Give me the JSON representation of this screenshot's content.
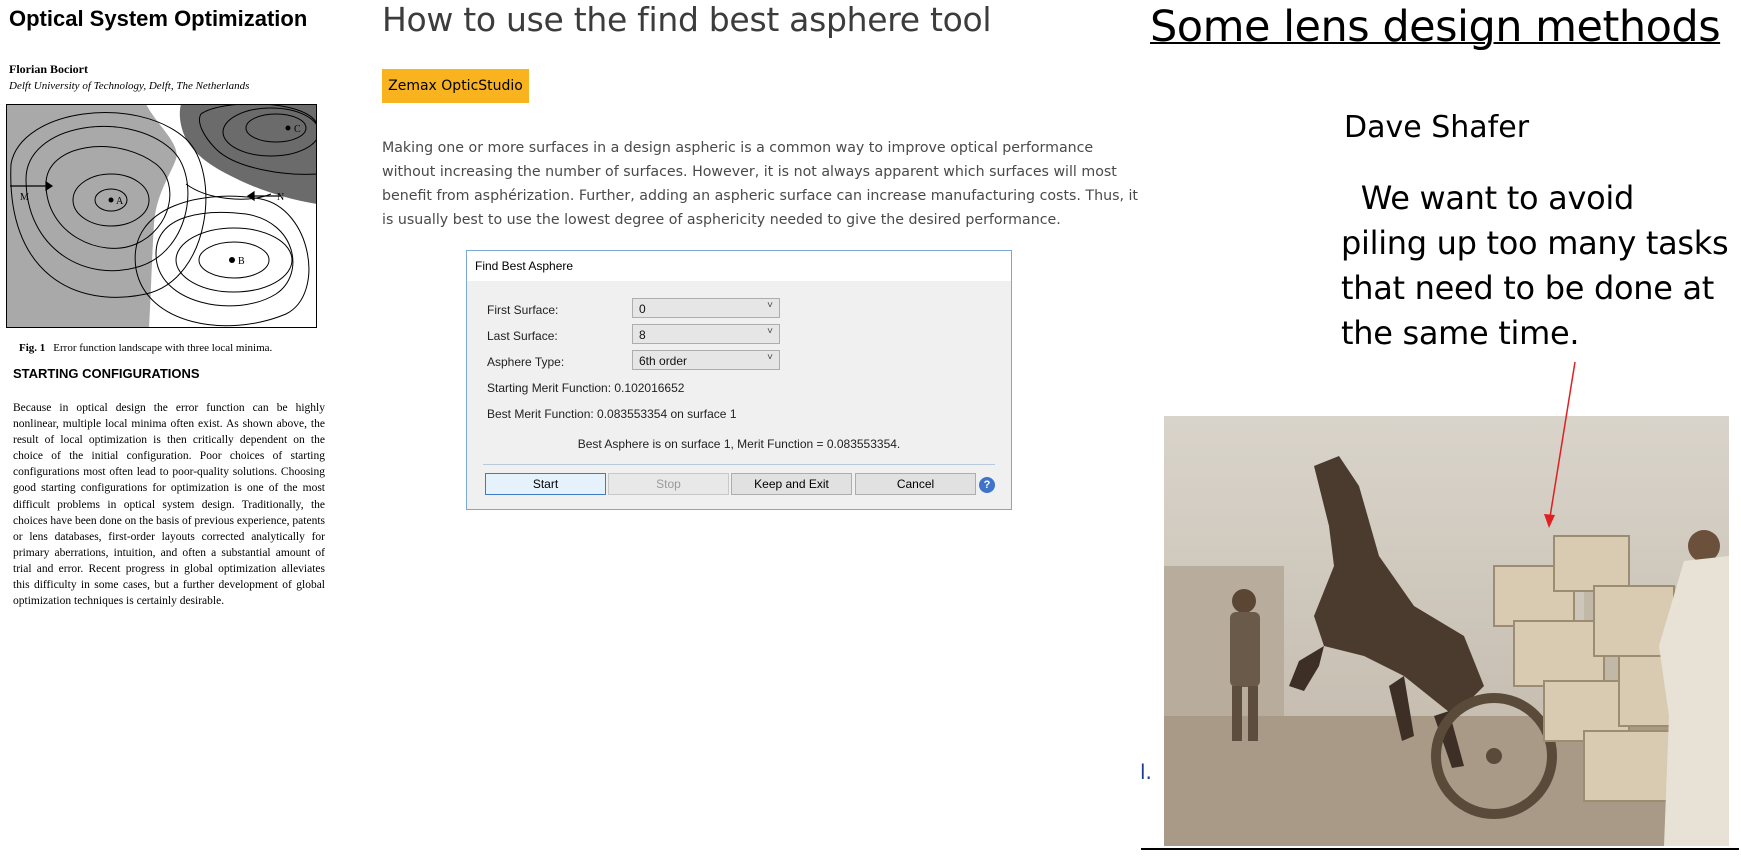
{
  "paper": {
    "title": "Optical System Optimization",
    "author": "Florian Bociort",
    "affiliation": "Delft University of Technology, Delft, The Netherlands",
    "figure": {
      "points": [
        "M",
        "A",
        "B",
        "C",
        "N"
      ],
      "caption_label": "Fig. 1",
      "caption_text": "Error function landscape with three local minima."
    },
    "section_heading": "STARTING CONFIGURATIONS",
    "body": "Because in optical design the error function can be highly nonlinear, multiple local minima often exist. As shown above, the result of local optimization is then critically dependent on the choice of the initial configuration. Poor choices of starting configurations most often lead to poor-quality solutions. Choosing good starting configurations for optimization is one of the most difficult problems in optical system design. Traditionally, the choices have been done on the basis of previous experience, patents or lens databases, first-order layouts corrected analytically for primary aberrations, intuition, and often a substantial amount of trial and error. Recent progress in global optimization alleviates this difficulty in some cases, but a further development of global optimization techniques is certainly desirable."
  },
  "article": {
    "title": "How to use the find best asphere tool",
    "tag": "Zemax OpticStudio",
    "tag_color": "#f8b31f",
    "paragraph": "Making one or more surfaces in a design aspheric is a common way to improve optical performance without increasing the number of surfaces. However, it is not always apparent which surfaces will most benefit from asphérization. Further, adding an aspheric surface can increase manufacturing costs. Thus, it is usually best to use the lowest degree of asphericity needed to give the desired performance."
  },
  "dialog": {
    "title": "Find Best Asphere",
    "first_surface_label": "First Surface:",
    "first_surface_value": "0",
    "last_surface_label": "Last Surface:",
    "last_surface_value": "8",
    "asphere_type_label": "Asphere Type:",
    "asphere_type_value": "6th order",
    "starting_merit": "Starting Merit Function: 0.102016652",
    "best_merit": "Best Merit Function: 0.083553354 on surface 1",
    "result": "Best Asphere is on surface 1, Merit Function = 0.083553354.",
    "buttons": {
      "start": "Start",
      "stop": "Stop",
      "keep_exit": "Keep and Exit",
      "cancel": "Cancel",
      "help": "?"
    }
  },
  "slide": {
    "title": "Some lens design methods",
    "author": "Dave Shafer",
    "quote": "  We want to avoid\npiling up too many tasks\nthat need to be done at\nthe same time.",
    "fragment": "l.",
    "arrow_color": "#e02020",
    "photo_icon": "overloaded-donkey-cart-photo"
  }
}
